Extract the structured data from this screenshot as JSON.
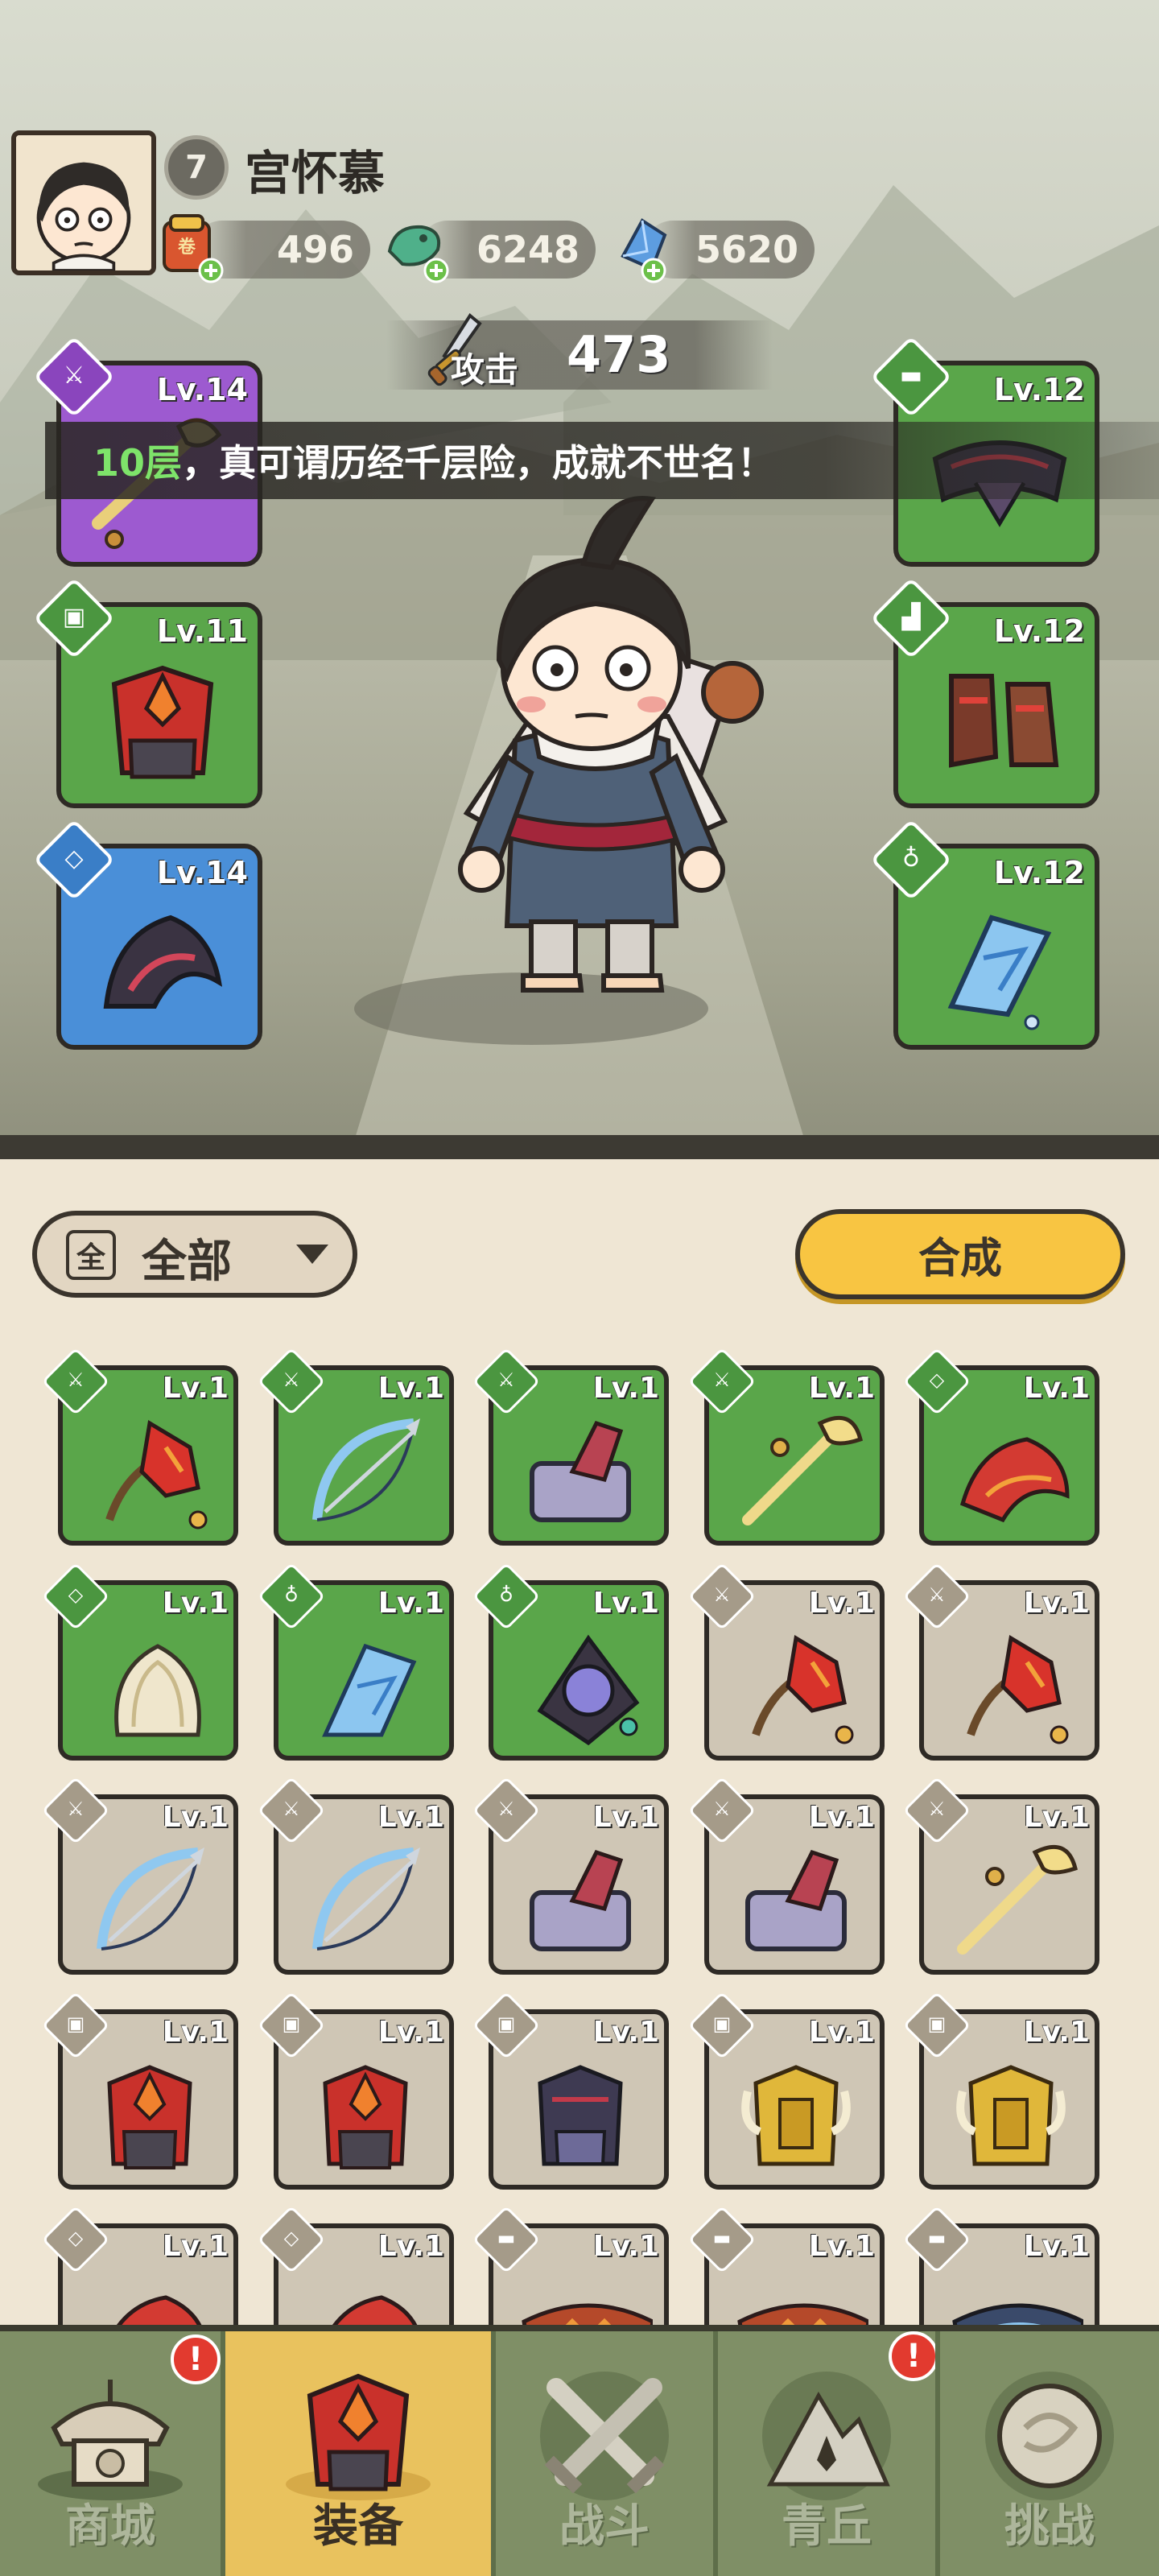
{
  "player": {
    "level": "7",
    "name": "宫怀慕"
  },
  "currencies": [
    {
      "icon": "scroll-bag-icon",
      "value": "496"
    },
    {
      "icon": "jade-dragon-icon",
      "value": "6248"
    },
    {
      "icon": "blue-crystal-icon",
      "value": "5620"
    }
  ],
  "attack": {
    "label": "攻击",
    "value": "473"
  },
  "banner": {
    "highlight": "10层",
    "text": "，真可谓历经千层险，成就不世名！"
  },
  "equipped": {
    "left": [
      {
        "slot": "weapon",
        "level": "Lv.14",
        "rarity": "purple"
      },
      {
        "slot": "armor",
        "level": "Lv.11",
        "rarity": "green"
      },
      {
        "slot": "accessory",
        "level": "Lv.14",
        "rarity": "blue"
      }
    ],
    "right": [
      {
        "slot": "belt",
        "level": "Lv.12",
        "rarity": "green"
      },
      {
        "slot": "boots",
        "level": "Lv.12",
        "rarity": "green"
      },
      {
        "slot": "pendant",
        "level": "Lv.12",
        "rarity": "green"
      }
    ]
  },
  "filter": {
    "box_char": "全",
    "label": "全部"
  },
  "merge_button": "合成",
  "inventory": [
    {
      "level": "Lv.1",
      "rarity": "green",
      "kind": "red-fan"
    },
    {
      "level": "Lv.1",
      "rarity": "green",
      "kind": "ice-bow"
    },
    {
      "level": "Lv.1",
      "rarity": "green",
      "kind": "stone-hammer"
    },
    {
      "level": "Lv.1",
      "rarity": "green",
      "kind": "gold-staff"
    },
    {
      "level": "Lv.1",
      "rarity": "green",
      "kind": "red-bracer"
    },
    {
      "level": "Lv.1",
      "rarity": "green",
      "kind": "lotus-bracer"
    },
    {
      "level": "Lv.1",
      "rarity": "green",
      "kind": "ice-pendant"
    },
    {
      "level": "Lv.1",
      "rarity": "green",
      "kind": "orb-pendant"
    },
    {
      "level": "Lv.1",
      "rarity": "gray",
      "kind": "red-fan"
    },
    {
      "level": "Lv.1",
      "rarity": "gray",
      "kind": "red-fan"
    },
    {
      "level": "Lv.1",
      "rarity": "gray",
      "kind": "ice-bow"
    },
    {
      "level": "Lv.1",
      "rarity": "gray",
      "kind": "ice-bow"
    },
    {
      "level": "Lv.1",
      "rarity": "gray",
      "kind": "stone-hammer"
    },
    {
      "level": "Lv.1",
      "rarity": "gray",
      "kind": "stone-hammer"
    },
    {
      "level": "Lv.1",
      "rarity": "gray",
      "kind": "gold-staff"
    },
    {
      "level": "Lv.1",
      "rarity": "gray",
      "kind": "red-armor"
    },
    {
      "level": "Lv.1",
      "rarity": "gray",
      "kind": "red-armor"
    },
    {
      "level": "Lv.1",
      "rarity": "gray",
      "kind": "dark-armor"
    },
    {
      "level": "Lv.1",
      "rarity": "gray",
      "kind": "gold-armor"
    },
    {
      "level": "Lv.1",
      "rarity": "gray",
      "kind": "gold-armor"
    },
    {
      "level": "Lv.1",
      "rarity": "gray",
      "kind": "red-bracer"
    },
    {
      "level": "Lv.1",
      "rarity": "gray",
      "kind": "red-bracer"
    },
    {
      "level": "Lv.1",
      "rarity": "gray",
      "kind": "lotus-belt"
    },
    {
      "level": "Lv.1",
      "rarity": "gray",
      "kind": "lotus-belt"
    },
    {
      "level": "Lv.1",
      "rarity": "gray",
      "kind": "blue-belt"
    }
  ],
  "nav": [
    {
      "label": "商城",
      "icon": "shop-icon",
      "alert": "!"
    },
    {
      "label": "装备",
      "icon": "equipment-icon",
      "active": true
    },
    {
      "label": "战斗",
      "icon": "crossed-swords-icon"
    },
    {
      "label": "青丘",
      "icon": "mountain-icon",
      "alert": "!"
    },
    {
      "label": "挑战",
      "icon": "challenge-disc-icon"
    }
  ],
  "colors": {
    "green_rarity": "#5aa64a",
    "purple_rarity": "#9d5ad0",
    "blue_rarity": "#4a8fd8",
    "gray_rarity": "#cfc6b5",
    "accent_button": "#f8c542",
    "nav_bar": "#7f8f66",
    "nav_active": "#e9c25e",
    "banner_highlight": "#7ee36a"
  }
}
